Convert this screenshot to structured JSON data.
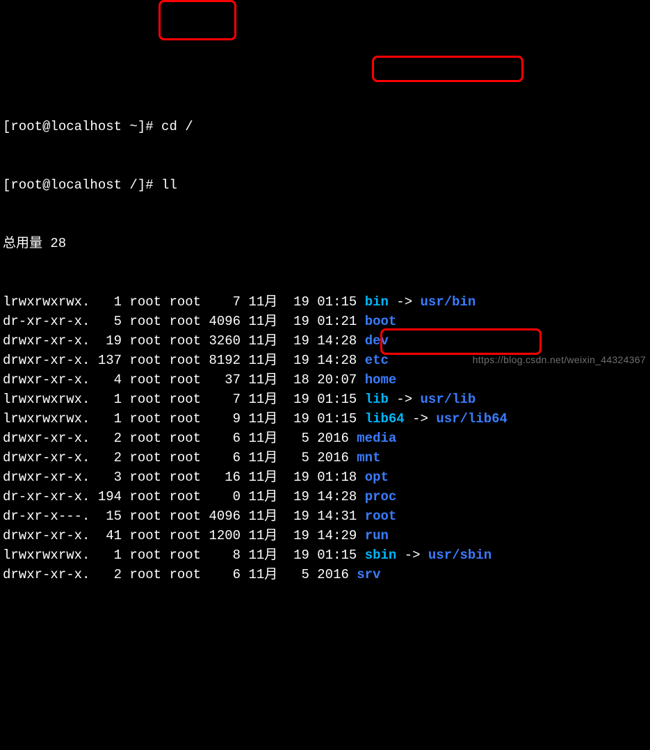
{
  "prompt1": {
    "prefix": "[root@localhost ~]# ",
    "cmd": "cd /"
  },
  "prompt2": {
    "prefix": "[root@localhost /]# ",
    "cmd": "ll"
  },
  "total_line": "总用量 28",
  "entries": [
    {
      "perm": "lrwxrwxrwx.",
      "links": "  1",
      "owner": "root",
      "group": "root",
      "size": "   7",
      "month": "11月",
      "day": " 19",
      "time": "01:15",
      "name": "bin",
      "type": "symlink",
      "target": "usr/bin"
    },
    {
      "perm": "dr-xr-xr-x.",
      "links": "  5",
      "owner": "root",
      "group": "root",
      "size": "4096",
      "month": "11月",
      "day": " 19",
      "time": "01:21",
      "name": "boot",
      "type": "dir"
    },
    {
      "perm": "drwxr-xr-x.",
      "links": " 19",
      "owner": "root",
      "group": "root",
      "size": "3260",
      "month": "11月",
      "day": " 19",
      "time": "14:28",
      "name": "dev",
      "type": "dir"
    },
    {
      "perm": "drwxr-xr-x.",
      "links": "137",
      "owner": "root",
      "group": "root",
      "size": "8192",
      "month": "11月",
      "day": " 19",
      "time": "14:28",
      "name": "etc",
      "type": "dir"
    },
    {
      "perm": "drwxr-xr-x.",
      "links": "  4",
      "owner": "root",
      "group": "root",
      "size": "  37",
      "month": "11月",
      "day": " 18",
      "time": "20:07",
      "name": "home",
      "type": "dir"
    },
    {
      "perm": "lrwxrwxrwx.",
      "links": "  1",
      "owner": "root",
      "group": "root",
      "size": "   7",
      "month": "11月",
      "day": " 19",
      "time": "01:15",
      "name": "lib",
      "type": "symlink",
      "target": "usr/lib"
    },
    {
      "perm": "lrwxrwxrwx.",
      "links": "  1",
      "owner": "root",
      "group": "root",
      "size": "   9",
      "month": "11月",
      "day": " 19",
      "time": "01:15",
      "name": "lib64",
      "type": "symlink",
      "target": "usr/lib64"
    },
    {
      "perm": "drwxr-xr-x.",
      "links": "  2",
      "owner": "root",
      "group": "root",
      "size": "   6",
      "month": "11月",
      "day": "  5",
      "time": "2016",
      "name": "media",
      "type": "dir"
    },
    {
      "perm": "drwxr-xr-x.",
      "links": "  2",
      "owner": "root",
      "group": "root",
      "size": "   6",
      "month": "11月",
      "day": "  5",
      "time": "2016",
      "name": "mnt",
      "type": "dir"
    },
    {
      "perm": "drwxr-xr-x.",
      "links": "  3",
      "owner": "root",
      "group": "root",
      "size": "  16",
      "month": "11月",
      "day": " 19",
      "time": "01:18",
      "name": "opt",
      "type": "dir"
    },
    {
      "perm": "dr-xr-xr-x.",
      "links": "194",
      "owner": "root",
      "group": "root",
      "size": "   0",
      "month": "11月",
      "day": " 19",
      "time": "14:28",
      "name": "proc",
      "type": "dir"
    },
    {
      "perm": "dr-xr-x---.",
      "links": " 15",
      "owner": "root",
      "group": "root",
      "size": "4096",
      "month": "11月",
      "day": " 19",
      "time": "14:31",
      "name": "root",
      "type": "dir"
    },
    {
      "perm": "drwxr-xr-x.",
      "links": " 41",
      "owner": "root",
      "group": "root",
      "size": "1200",
      "month": "11月",
      "day": " 19",
      "time": "14:29",
      "name": "run",
      "type": "dir"
    },
    {
      "perm": "lrwxrwxrwx.",
      "links": "  1",
      "owner": "root",
      "group": "root",
      "size": "   8",
      "month": "11月",
      "day": " 19",
      "time": "01:15",
      "name": "sbin",
      "type": "symlink",
      "target": "usr/sbin"
    },
    {
      "perm": "drwxr-xr-x.",
      "links": "  2",
      "owner": "root",
      "group": "root",
      "size": "   6",
      "month": "11月",
      "day": "  5",
      "time": "2016",
      "name": "srv",
      "type": "dir"
    }
  ],
  "watermark": "https://blog.csdn.net/weixin_44324367"
}
